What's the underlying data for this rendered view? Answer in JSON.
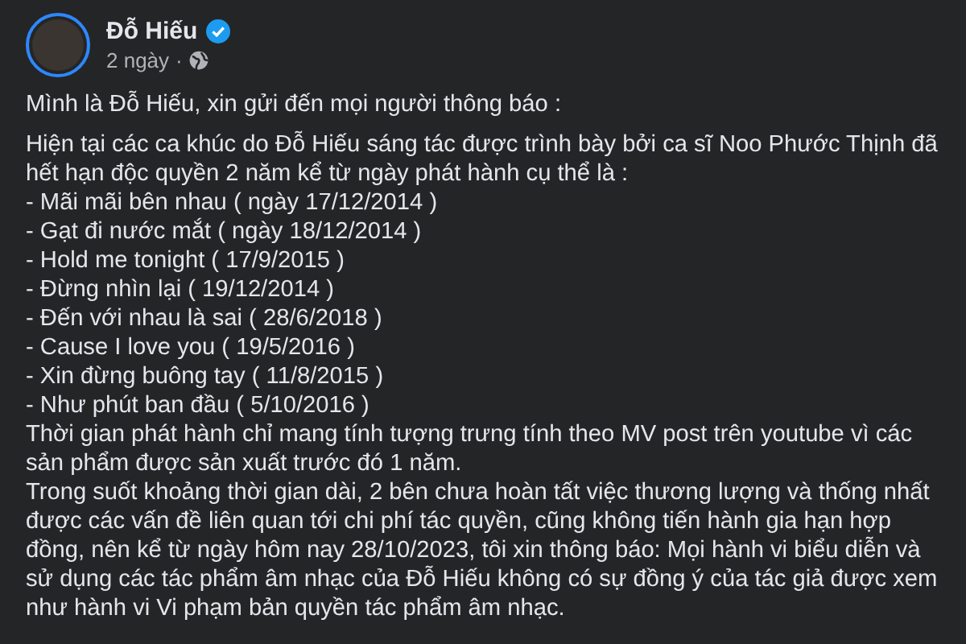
{
  "post": {
    "author": "Đỗ Hiếu",
    "verified": true,
    "time": "2 ngày",
    "separator": "·",
    "paragraphs": [
      {
        "lines": [
          "Mình là Đỗ Hiếu, xin gửi đến mọi người thông báo :"
        ]
      },
      {
        "lines": [
          "Hiện tại các ca khúc do Đỗ Hiếu sáng tác được trình bày bởi ca sĩ Noo Phước Thịnh đã hết hạn độc quyền 2 năm kể từ ngày phát hành cụ thể là :",
          "- Mãi mãi bên nhau ( ngày 17/12/2014 )",
          "- Gạt đi nước mắt ( ngày 18/12/2014 )",
          "- Hold me tonight ( 17/9/2015 )",
          "- Đừng nhìn lại ( 19/12/2014 )",
          "- Đến với nhau là sai ( 28/6/2018 )",
          "- Cause I love you ( 19/5/2016 )",
          "- Xin đừng buông tay ( 11/8/2015 )",
          "- Như phút ban đầu ( 5/10/2016 )",
          "Thời gian phát hành chỉ mang tính tượng trưng tính theo MV post trên youtube vì các sản phẩm được sản xuất trước đó 1 năm.",
          "Trong suốt khoảng thời gian dài, 2 bên chưa hoàn tất việc thương lượng và thống nhất được các vấn đề liên quan tới chi phí tác quyền, cũng không tiến hành gia hạn hợp đồng, nên kể từ ngày hôm nay 28/10/2023, tôi xin thông báo: Mọi hành vi biểu diễn và sử dụng các tác phẩm âm nhạc của Đỗ Hiếu không có sự đồng ý của tác giả được xem như hành vi Vi phạm bản quyền tác phẩm âm nhạc."
        ]
      }
    ]
  }
}
